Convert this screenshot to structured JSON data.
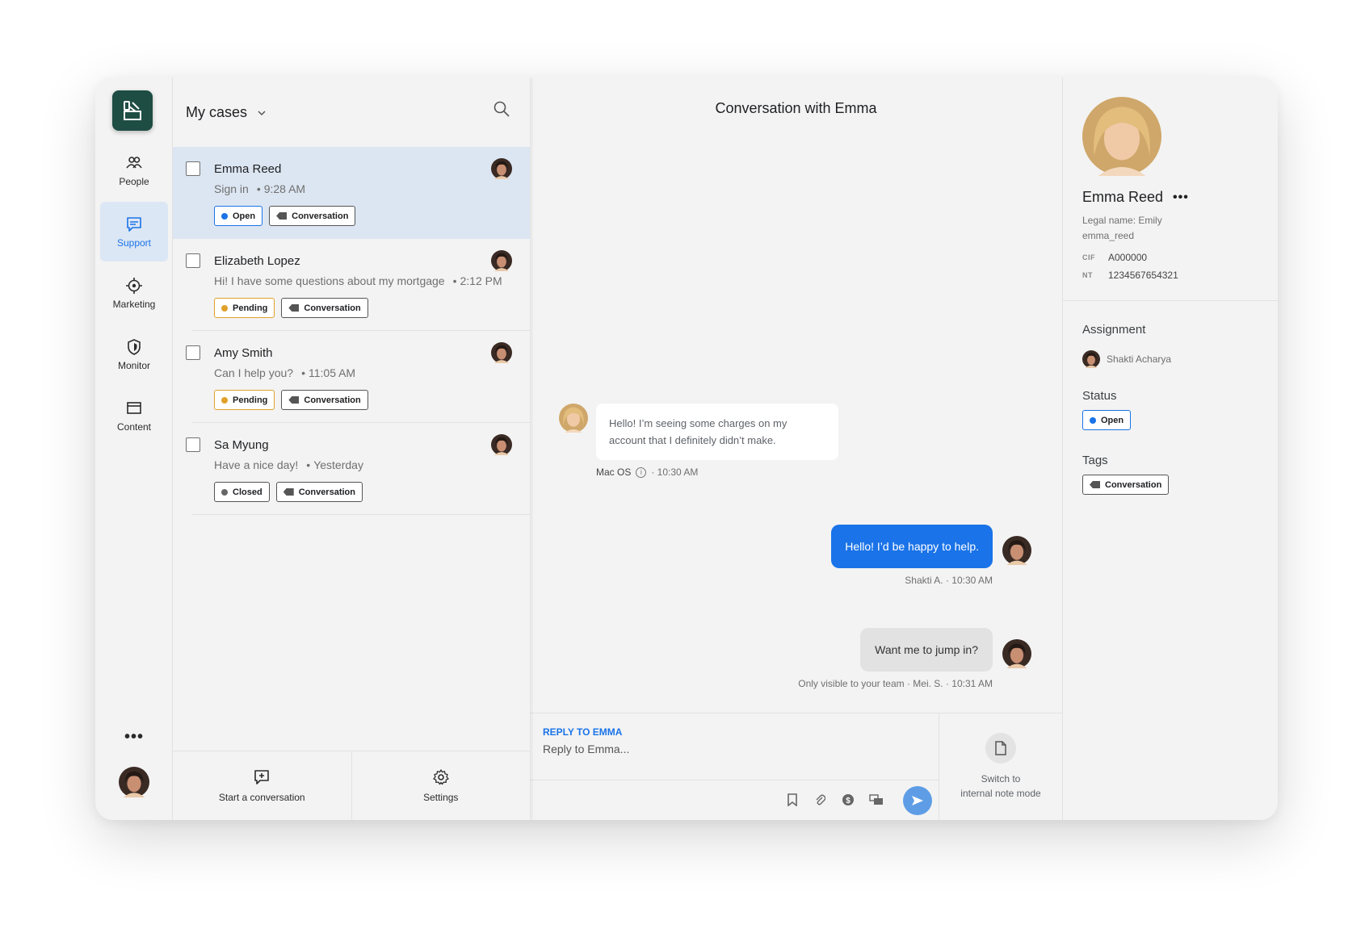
{
  "nav": {
    "items": [
      {
        "label": "People",
        "icon": "people-icon"
      },
      {
        "label": "Support",
        "icon": "support-chat-icon",
        "active": true
      },
      {
        "label": "Marketing",
        "icon": "target-icon"
      },
      {
        "label": "Monitor",
        "icon": "shield-icon"
      },
      {
        "label": "Content",
        "icon": "window-icon"
      }
    ],
    "more": "•••"
  },
  "cases": {
    "title": "My cases",
    "items": [
      {
        "name": "Emma Reed",
        "preview": "Sign in",
        "time": "9:28 AM",
        "status": "Open",
        "tag": "Conversation",
        "selected": true
      },
      {
        "name": "Elizabeth Lopez",
        "preview": "Hi! I have some questions about my mortgage",
        "time": "2:12 PM",
        "status": "Pending",
        "tag": "Conversation"
      },
      {
        "name": "Amy Smith",
        "preview": "Can I help you?",
        "time": "11:05 AM",
        "status": "Pending",
        "tag": "Conversation"
      },
      {
        "name": "Sa Myung",
        "preview": "Have a nice day!",
        "time": "Yesterday",
        "status": "Closed",
        "tag": "Conversation"
      }
    ],
    "footer": {
      "start": "Start a conversation",
      "settings": "Settings"
    }
  },
  "conversation": {
    "title": "Conversation with Emma",
    "incoming": {
      "text": "Hello! I’m seeing some charges on my account that I definitely didn’t make.",
      "device": "Mac OS",
      "time": "· 10:30 AM"
    },
    "outgoing": {
      "text": "Hello! I’d be happy to help.",
      "meta": "Shakti A. · 10:30 AM"
    },
    "note": {
      "text": "Want me to jump in?",
      "meta": "Only visible to your team · Mei. S. · 10:31 AM"
    },
    "composer": {
      "label": "REPLY TO EMMA",
      "placeholder": "Reply to Emma...",
      "switch_line1": "Switch to",
      "switch_line2": "internal note mode"
    }
  },
  "profile": {
    "name": "Emma Reed",
    "more": "•••",
    "legal_name": "Legal name: Emily",
    "username": "emma_reed",
    "fields": [
      {
        "key": "CIF",
        "value": "A000000"
      },
      {
        "key": "NT",
        "value": "1234567654321"
      }
    ],
    "assignment_label": "Assignment",
    "assignee": "Shakti Acharya",
    "status_label": "Status",
    "status": "Open",
    "tags_label": "Tags",
    "tag": "Conversation"
  },
  "colors": {
    "accent": "#1a73e8",
    "pending": "#e0a12a",
    "brand": "#1e4d44",
    "selected_row": "#dce6f2"
  }
}
